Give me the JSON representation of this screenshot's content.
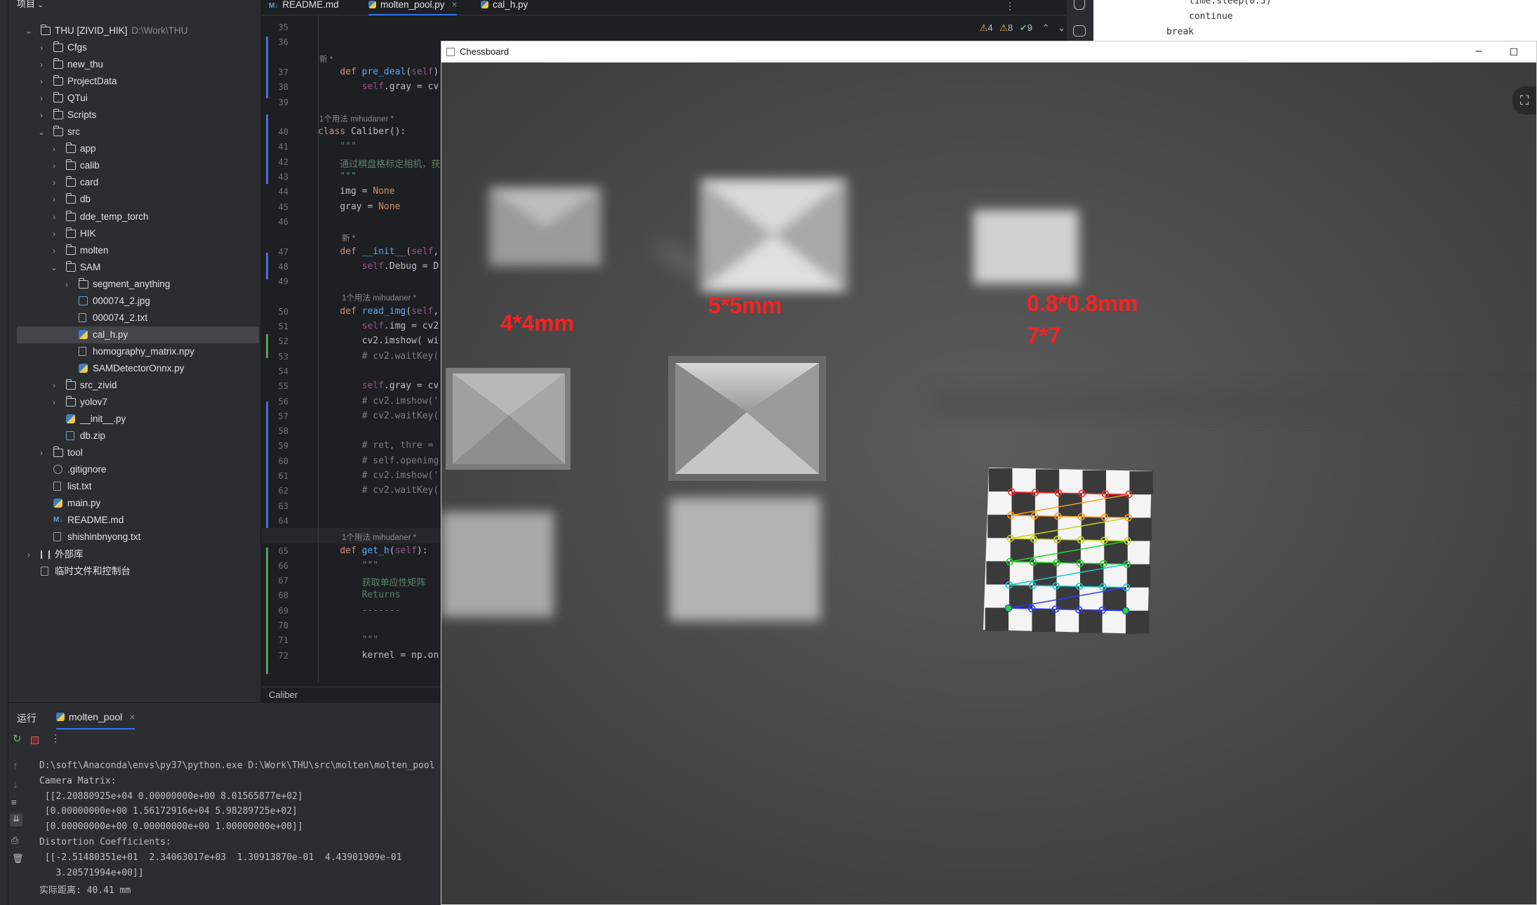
{
  "project": {
    "header": "项目",
    "root_name": "THU [ZIVID_HIK]",
    "root_path": "D:\\Work\\THU",
    "items": [
      {
        "label": "Cfgs",
        "type": "folder",
        "depth": 1,
        "expanded": false
      },
      {
        "label": "new_thu",
        "type": "folder",
        "depth": 1,
        "expanded": false
      },
      {
        "label": "ProjectData",
        "type": "folder",
        "depth": 1,
        "expanded": false
      },
      {
        "label": "QTui",
        "type": "folder",
        "depth": 1,
        "expanded": false
      },
      {
        "label": "Scripts",
        "type": "folder",
        "depth": 1,
        "expanded": false
      },
      {
        "label": "src",
        "type": "folder",
        "depth": 1,
        "expanded": true
      },
      {
        "label": "app",
        "type": "folder",
        "depth": 2,
        "expanded": false
      },
      {
        "label": "calib",
        "type": "folder",
        "depth": 2,
        "expanded": false
      },
      {
        "label": "card",
        "type": "folder",
        "depth": 2,
        "expanded": false
      },
      {
        "label": "db",
        "type": "folder",
        "depth": 2,
        "expanded": false
      },
      {
        "label": "dde_temp_torch",
        "type": "folder",
        "depth": 2,
        "expanded": false
      },
      {
        "label": "HIK",
        "type": "folder",
        "depth": 2,
        "expanded": false
      },
      {
        "label": "molten",
        "type": "folder",
        "depth": 2,
        "expanded": false
      },
      {
        "label": "SAM",
        "type": "folder",
        "depth": 2,
        "expanded": true
      },
      {
        "label": "segment_anything",
        "type": "folder",
        "depth": 3,
        "expanded": false
      },
      {
        "label": "000074_2.jpg",
        "type": "image",
        "depth": 3
      },
      {
        "label": "000074_2.txt",
        "type": "text",
        "depth": 3
      },
      {
        "label": "cal_h.py",
        "type": "python",
        "depth": 3,
        "selected": true
      },
      {
        "label": "homography_matrix.npy",
        "type": "file",
        "depth": 3
      },
      {
        "label": "SAMDetectorOnnx.py",
        "type": "python",
        "depth": 3
      },
      {
        "label": "src_zivid",
        "type": "folder",
        "depth": 2,
        "expanded": false
      },
      {
        "label": "yolov7",
        "type": "folder",
        "depth": 2,
        "expanded": false
      },
      {
        "label": "__init__.py",
        "type": "python",
        "depth": 2
      },
      {
        "label": "db.zip",
        "type": "zip",
        "depth": 2
      },
      {
        "label": "tool",
        "type": "folder",
        "depth": 1,
        "expanded": false
      },
      {
        "label": ".gitignore",
        "type": "git",
        "depth": 1
      },
      {
        "label": "list.txt",
        "type": "text",
        "depth": 1
      },
      {
        "label": "main.py",
        "type": "python",
        "depth": 1
      },
      {
        "label": "README.md",
        "type": "md",
        "depth": 1
      },
      {
        "label": "shishinbnyong.txt",
        "type": "text",
        "depth": 1
      },
      {
        "label": "外部库",
        "type": "lib",
        "depth": 0,
        "expanded": false
      },
      {
        "label": "临时文件和控制台",
        "type": "console",
        "depth": 0
      }
    ]
  },
  "editor": {
    "tabs": [
      {
        "label": "README.md",
        "icon": "md-icon",
        "active": false
      },
      {
        "label": "molten_pool.py",
        "icon": "python-icon",
        "active": true
      },
      {
        "label": "cal_h.py",
        "icon": "python-icon",
        "active": false
      }
    ],
    "inspections": {
      "warnings": "4",
      "weak": "8",
      "ok": "9"
    },
    "breadcrumb": "Caliber",
    "lines": [
      {
        "n": "35",
        "text": ""
      },
      {
        "n": "36",
        "text": ""
      },
      {
        "hint": "新 *"
      },
      {
        "n": "37",
        "kind": "def",
        "text": "    def pre_deal(self)"
      },
      {
        "n": "38",
        "text": "        self.gray = cv"
      },
      {
        "n": "39",
        "text": ""
      },
      {
        "hint": "1个用法   mihudaner *"
      },
      {
        "n": "40",
        "kind": "class",
        "text": "class Caliber():"
      },
      {
        "n": "41",
        "kind": "doc",
        "text": "    \"\"\""
      },
      {
        "n": "42",
        "kind": "doc",
        "text": "    通过棋盘格标定相机，获"
      },
      {
        "n": "43",
        "kind": "doc",
        "text": "    \"\"\""
      },
      {
        "n": "44",
        "kind": "none",
        "text": "    img = None"
      },
      {
        "n": "45",
        "kind": "none",
        "text": "    gray = None"
      },
      {
        "n": "46",
        "text": ""
      },
      {
        "hint": "新 *"
      },
      {
        "n": "47",
        "kind": "def",
        "text": "    def __init__(self,"
      },
      {
        "n": "48",
        "text": "        self.Debug = D"
      },
      {
        "n": "49",
        "text": ""
      },
      {
        "hint": "1个用法   mihudaner *"
      },
      {
        "n": "50",
        "kind": "def",
        "text": "    def read_img(self,"
      },
      {
        "n": "51",
        "text": "        self.img = cv2"
      },
      {
        "n": "52",
        "text": "        cv2.imshow( wi"
      },
      {
        "n": "53",
        "kind": "comment",
        "text": "        # cv2.waitKey("
      },
      {
        "n": "54",
        "text": ""
      },
      {
        "n": "55",
        "text": "        self.gray = cv"
      },
      {
        "n": "56",
        "kind": "comment",
        "text": "        # cv2.imshow('"
      },
      {
        "n": "57",
        "kind": "comment",
        "text": "        # cv2.waitKey("
      },
      {
        "n": "58",
        "text": ""
      },
      {
        "n": "59",
        "kind": "comment",
        "text": "        # ret, thre = "
      },
      {
        "n": "60",
        "kind": "comment",
        "text": "        # self.openimg"
      },
      {
        "n": "61",
        "kind": "comment",
        "text": "        # cv2.imshow('"
      },
      {
        "n": "62",
        "kind": "comment",
        "text": "        # cv2.waitKey("
      },
      {
        "n": "63",
        "text": ""
      },
      {
        "n": "64",
        "text": ""
      },
      {
        "hint": "1个用法   mihudaner *"
      },
      {
        "n": "65",
        "kind": "def",
        "text": "    def get_h(self):"
      },
      {
        "n": "66",
        "kind": "doc",
        "text": "        \"\"\""
      },
      {
        "n": "67",
        "kind": "doc",
        "text": "        获取单应性矩阵"
      },
      {
        "n": "68",
        "kind": "doc",
        "text": "        Returns"
      },
      {
        "n": "69",
        "kind": "doc",
        "text": "        -------"
      },
      {
        "n": "70",
        "text": ""
      },
      {
        "n": "71",
        "kind": "doc",
        "text": "        \"\"\""
      },
      {
        "n": "72",
        "text": "        kernel = np.on"
      }
    ]
  },
  "right_peek": {
    "lines": [
      "time.sleep(0.3)",
      "continue",
      "break"
    ]
  },
  "run": {
    "title": "运行",
    "tab": "molten_pool",
    "output": [
      "D:\\soft\\Anaconda\\envs\\py37\\python.exe D:\\Work\\THU\\src\\molten\\molten_pool",
      "Camera Matrix:",
      " [[2.20880925e+04 0.00000000e+00 8.01565877e+02]",
      " [0.00000000e+00 1.56172916e+04 5.98289725e+02]",
      " [0.00000000e+00 0.00000000e+00 1.00000000e+00]]",
      "Distortion Coefficients:",
      " [[-2.51480351e+01  2.34063017e+03  1.30913870e-01  4.43901909e-01",
      "   3.20571994e+00]]",
      "实际距离: 40.41 mm"
    ]
  },
  "chessboard_window": {
    "title": "Chessboard",
    "labels": {
      "label_4mm": "4*4mm",
      "label_5mm": "5*5mm",
      "label_08mm": "0.8*0.8mm",
      "label_grid": "7*7"
    },
    "corner_row_colors": [
      "#ff2a2a",
      "#ff9a1a",
      "#c8d21a",
      "#22d42a",
      "#19c7c7",
      "#2a3cff"
    ]
  }
}
